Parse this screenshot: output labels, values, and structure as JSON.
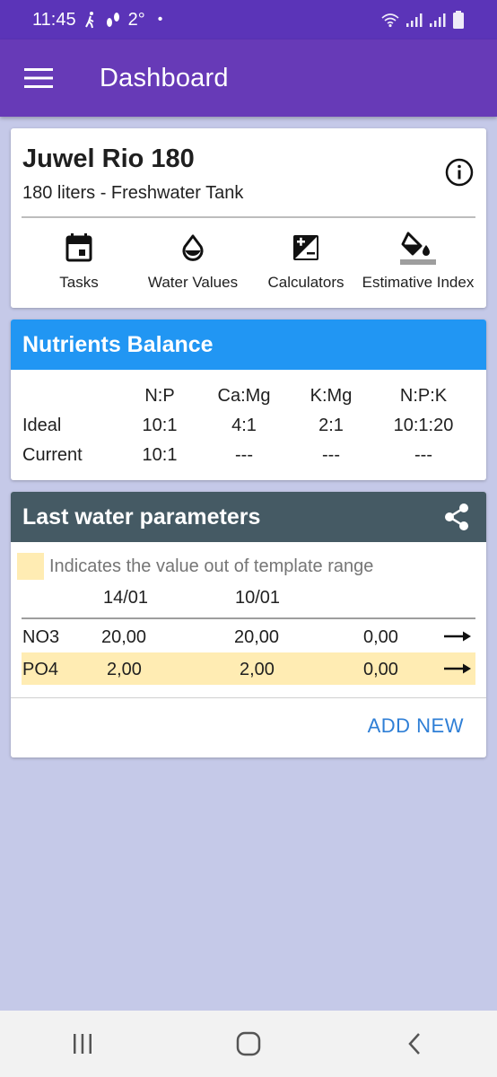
{
  "status_bar": {
    "time": "11:45",
    "temperature": "2°",
    "dot": "•",
    "icons": [
      "walking-icon",
      "footsteps-icon",
      "wifi-icon",
      "signal-icon",
      "signal-icon",
      "battery-icon"
    ]
  },
  "app_bar": {
    "title": "Dashboard",
    "menu_icon": "hamburger-menu-icon"
  },
  "tank": {
    "name": "Juwel Rio 180",
    "description": "180 liters - Freshwater Tank",
    "info_icon": "info-icon",
    "actions": [
      {
        "label": "Tasks",
        "icon": "calendar-icon"
      },
      {
        "label": "Water Values",
        "icon": "water-drop-icon"
      },
      {
        "label": "Calculators",
        "icon": "calculator-icon"
      },
      {
        "label": "Estimative Index",
        "icon": "paint-bucket-icon"
      }
    ]
  },
  "nutrients": {
    "title": "Nutrients Balance",
    "header_color": "#2196f3",
    "columns": [
      "N:P",
      "Ca:Mg",
      "K:Mg",
      "N:P:K"
    ],
    "rows": [
      {
        "label": "Ideal",
        "values": [
          "10:1",
          "4:1",
          "2:1",
          "10:1:20"
        ]
      },
      {
        "label": "Current",
        "values": [
          "10:1",
          "---",
          "---",
          "---"
        ]
      }
    ]
  },
  "parameters": {
    "title": "Last water parameters",
    "header_color": "#455a64",
    "share_icon": "share-icon",
    "legend_text": "Indicates the value out of template range",
    "out_of_range_color": "#ffecb3",
    "dates": [
      "14/01",
      "10/01"
    ],
    "rows": [
      {
        "name": "NO3",
        "values": [
          "20,00",
          "20,00",
          "0,00"
        ],
        "out_of_range": false,
        "icon": "arrow-right-icon"
      },
      {
        "name": "PO4",
        "values": [
          "2,00",
          "2,00",
          "0,00"
        ],
        "out_of_range": true,
        "icon": "arrow-right-icon"
      }
    ],
    "add_new_label": "ADD NEW"
  },
  "nav_bar": {
    "buttons": [
      "recent-apps-icon",
      "home-icon",
      "back-icon"
    ]
  }
}
